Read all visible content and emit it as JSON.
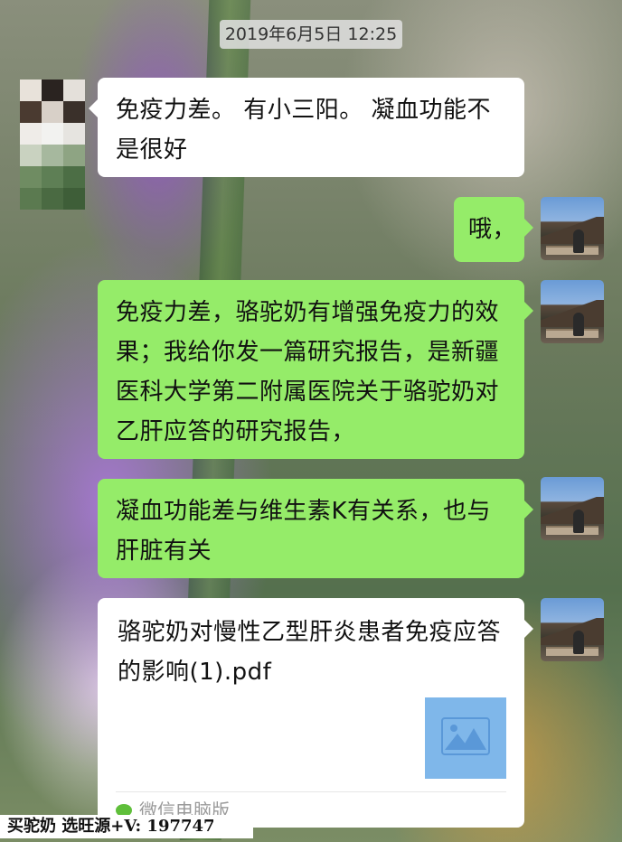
{
  "chat": {
    "timestamp": "2019年6月5日 12:25",
    "messages": [
      {
        "side": "left",
        "text": "免疫力差。 有小三阳。 凝血功能不是很好"
      },
      {
        "side": "right",
        "text": "哦，"
      },
      {
        "side": "right",
        "text": "免疫力差，骆驼奶有增强免疫力的效果；我给你发一篇研究报告，是新疆医科大学第二附属医院关于骆驼奶对乙肝应答的研究报告，"
      },
      {
        "side": "right",
        "text": "凝血功能差与维生素K有关系，也与肝脏有关"
      }
    ],
    "file": {
      "name": "骆驼奶对慢性乙型肝炎患者免疫应答的影响(1).pdf",
      "source": "微信电脑版"
    }
  },
  "watermark": "买驼奶 选旺源+V: 197747",
  "colors": {
    "sent_bubble": "#95ec69",
    "received_bubble": "#ffffff"
  }
}
